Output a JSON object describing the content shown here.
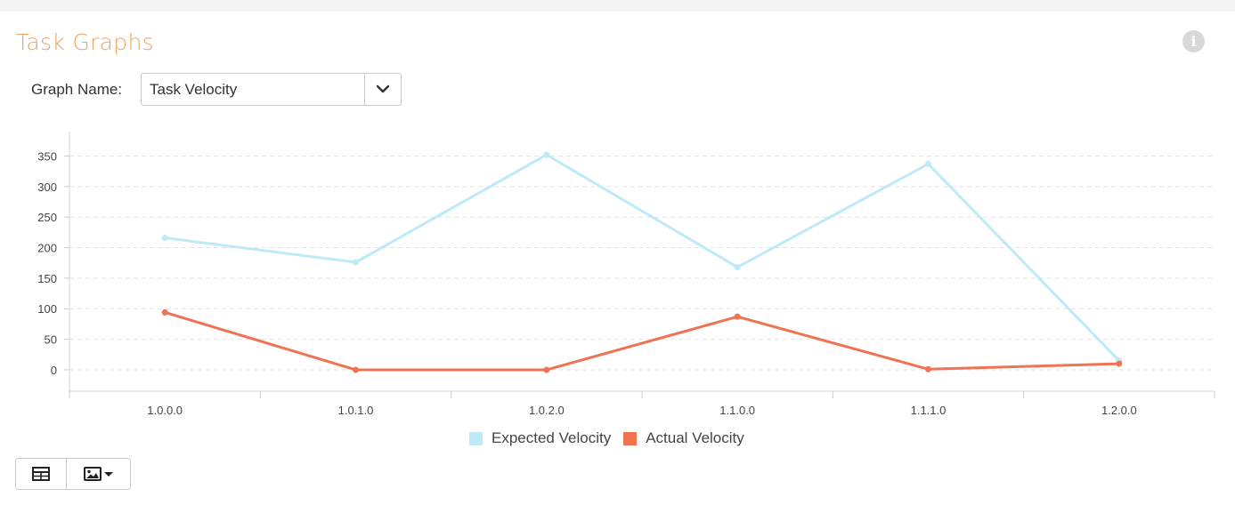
{
  "page": {
    "title": "Task Graphs",
    "graph_name_label": "Graph Name:",
    "graph_name_value": "Task Velocity"
  },
  "icons": {
    "info": "info-icon",
    "dropdown": "chevron-down-icon",
    "table_view": "table-icon",
    "image_export": "image-icon"
  },
  "chart_data": {
    "type": "line",
    "title": "",
    "xlabel": "",
    "ylabel": "",
    "categories": [
      "1.0.0.0",
      "1.0.1.0",
      "1.0.2.0",
      "1.1.0.0",
      "1.1.1.0",
      "1.2.0.0"
    ],
    "series": [
      {
        "name": "Expected Velocity",
        "color": "#bde9f8",
        "values": [
          216,
          176,
          352,
          168,
          337,
          15
        ]
      },
      {
        "name": "Actual Velocity",
        "color": "#ef7352",
        "values": [
          94,
          0,
          0,
          87,
          1,
          10
        ]
      }
    ],
    "yticks": [
      0,
      50,
      100,
      150,
      200,
      250,
      300,
      350
    ],
    "ylim": [
      -35,
      390
    ],
    "grid": true,
    "legend_position": "bottom-center"
  }
}
